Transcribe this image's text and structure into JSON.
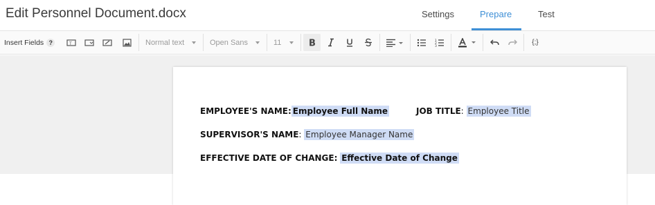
{
  "header": {
    "title": "Edit Personnel Document.docx",
    "tabs": [
      {
        "label": "Settings",
        "active": false
      },
      {
        "label": "Prepare",
        "active": true
      },
      {
        "label": "Test",
        "active": false
      }
    ]
  },
  "toolbar": {
    "insert_fields_label": "Insert Fields",
    "help_label": "?",
    "style_select": "Normal text",
    "font_select": "Open Sans",
    "size_select": "11",
    "code_label": "{;}",
    "accent_color": "#3e8fd6"
  },
  "document": {
    "rows": [
      {
        "label": "EMPLOYEE'S NAME:",
        "field": "Employee Full Name",
        "second_label": "JOB TITLE",
        "second_sep": ":",
        "second_field": "Employee Title"
      },
      {
        "label": "SUPERVISOR'S NAME",
        "sep": ":",
        "field": "Employee Manager Name"
      },
      {
        "label": "EFFECTIVE DATE OF CHANGE:",
        "field": "Effective Date of Change"
      }
    ],
    "field_highlight_color": "#cfdcf5"
  }
}
